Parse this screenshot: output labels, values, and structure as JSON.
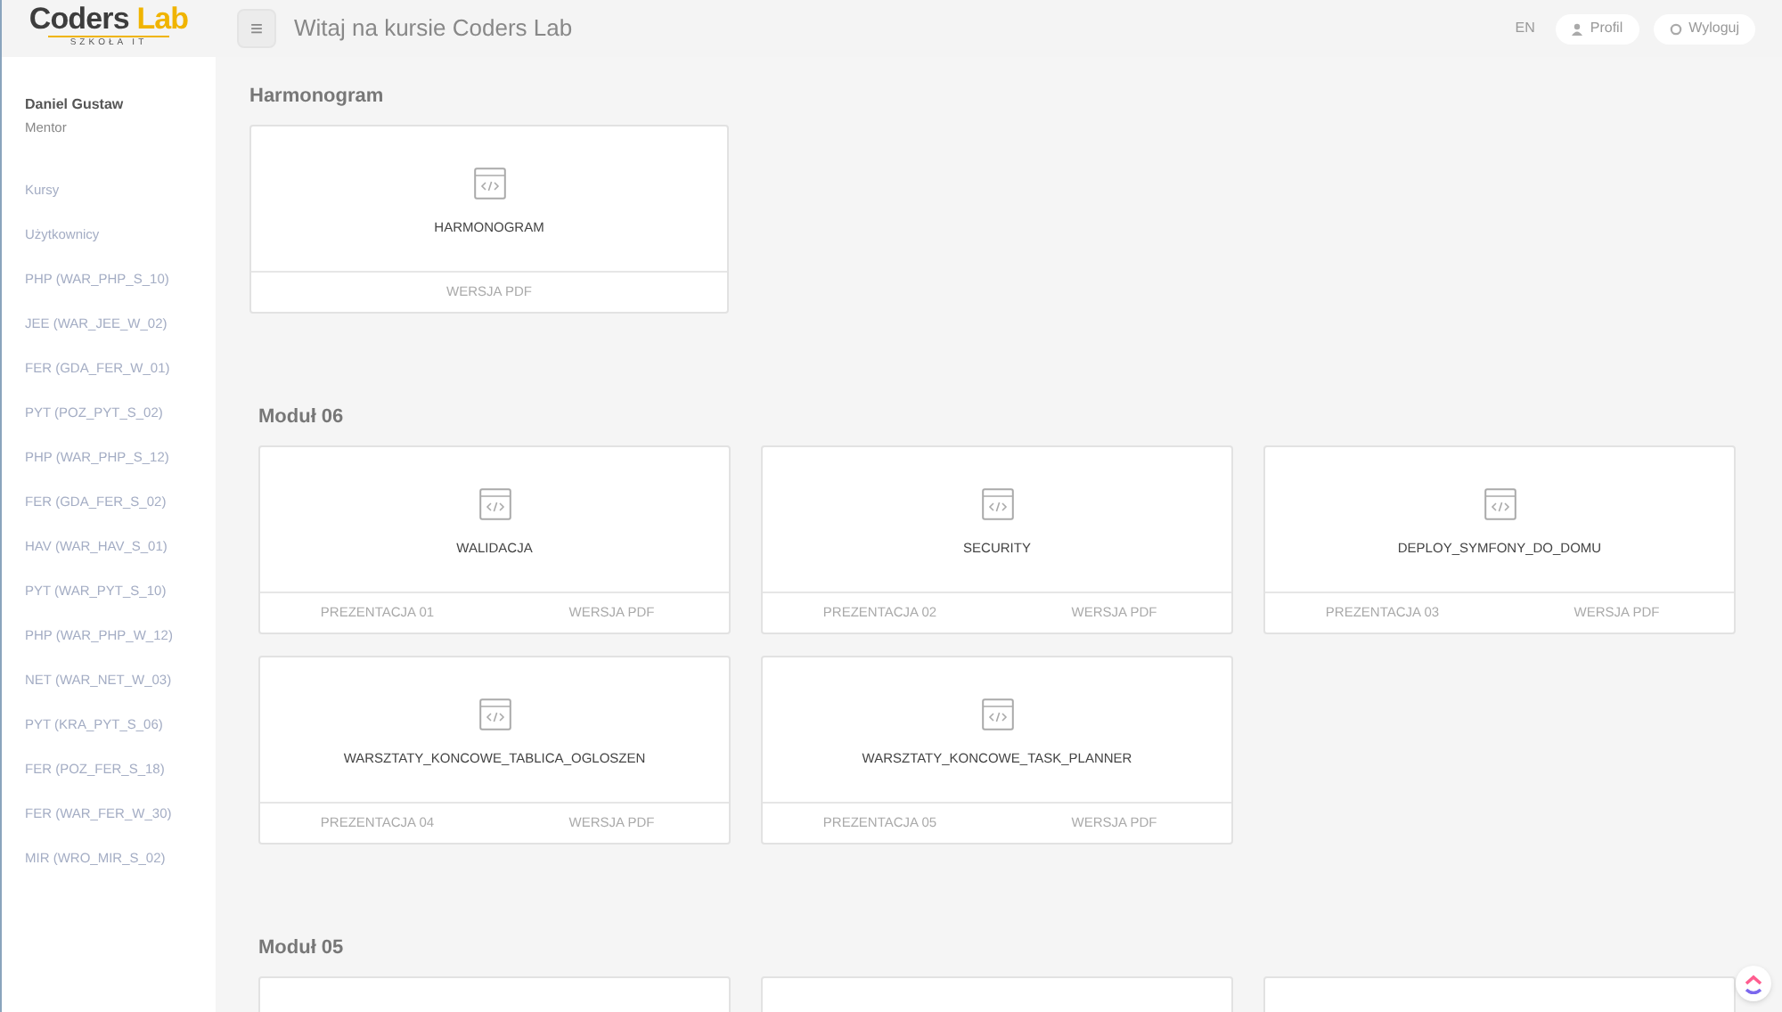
{
  "header": {
    "logo": {
      "word_1": "Coders",
      "word_2": "Lab",
      "subtitle": "SZKOŁA IT"
    },
    "menu_button": "≡",
    "title": "Witaj na kursie Coders Lab",
    "language": "EN",
    "buttons": [
      {
        "label": "Profil",
        "kind": "profile"
      },
      {
        "label": "Wyloguj",
        "kind": "logout"
      }
    ]
  },
  "sidebar": {
    "user_name": "Daniel Gustaw",
    "user_role": "Mentor",
    "items": [
      "Kursy",
      "Użytkownicy",
      "PHP (WAR_PHP_S_10)",
      "JEE (WAR_JEE_W_02)",
      "FER (GDA_FER_W_01)",
      "PYT (POZ_PYT_S_02)",
      "PHP (WAR_PHP_S_12)",
      "FER (GDA_FER_S_02)",
      "HAV (WAR_HAV_S_01)",
      "PYT (WAR_PYT_S_10)",
      "PHP (WAR_PHP_W_12)",
      "NET (WAR_NET_W_03)",
      "PYT (KRA_PYT_S_06)",
      "FER (POZ_FER_S_18)",
      "FER (WAR_FER_W_30)",
      "MIR (WRO_MIR_S_02)"
    ]
  },
  "sections": [
    {
      "title": "Harmonogram",
      "kind": "schedule",
      "cards": [
        {
          "kind": "full",
          "title": "HARMONOGRAM",
          "links": [
            "WERSJA PDF"
          ]
        }
      ]
    },
    {
      "title": "Moduł 06",
      "kind": "module",
      "cards": [
        {
          "kind": "full",
          "title": "WALIDACJA",
          "links": [
            "PREZENTACJA 01",
            "WERSJA PDF"
          ]
        },
        {
          "kind": "full",
          "title": "SECURITY",
          "links": [
            "PREZENTACJA 02",
            "WERSJA PDF"
          ]
        },
        {
          "kind": "full",
          "title": "DEPLOY_SYMFONY_DO_DOMU",
          "links": [
            "PREZENTACJA 03",
            "WERSJA PDF"
          ]
        },
        {
          "kind": "full",
          "title": "WARSZTATY_KONCOWE_TABLICA_OGLOSZEN",
          "links": [
            "PREZENTACJA 04",
            "WERSJA PDF"
          ]
        },
        {
          "kind": "full",
          "title": "WARSZTATY_KONCOWE_TASK_PLANNER",
          "links": [
            "PREZENTACJA 05",
            "WERSJA PDF"
          ]
        }
      ]
    },
    {
      "title": "Moduł 05",
      "kind": "module",
      "cards": [
        {
          "kind": "cut"
        },
        {
          "kind": "cut"
        },
        {
          "kind": "cut"
        }
      ]
    }
  ]
}
